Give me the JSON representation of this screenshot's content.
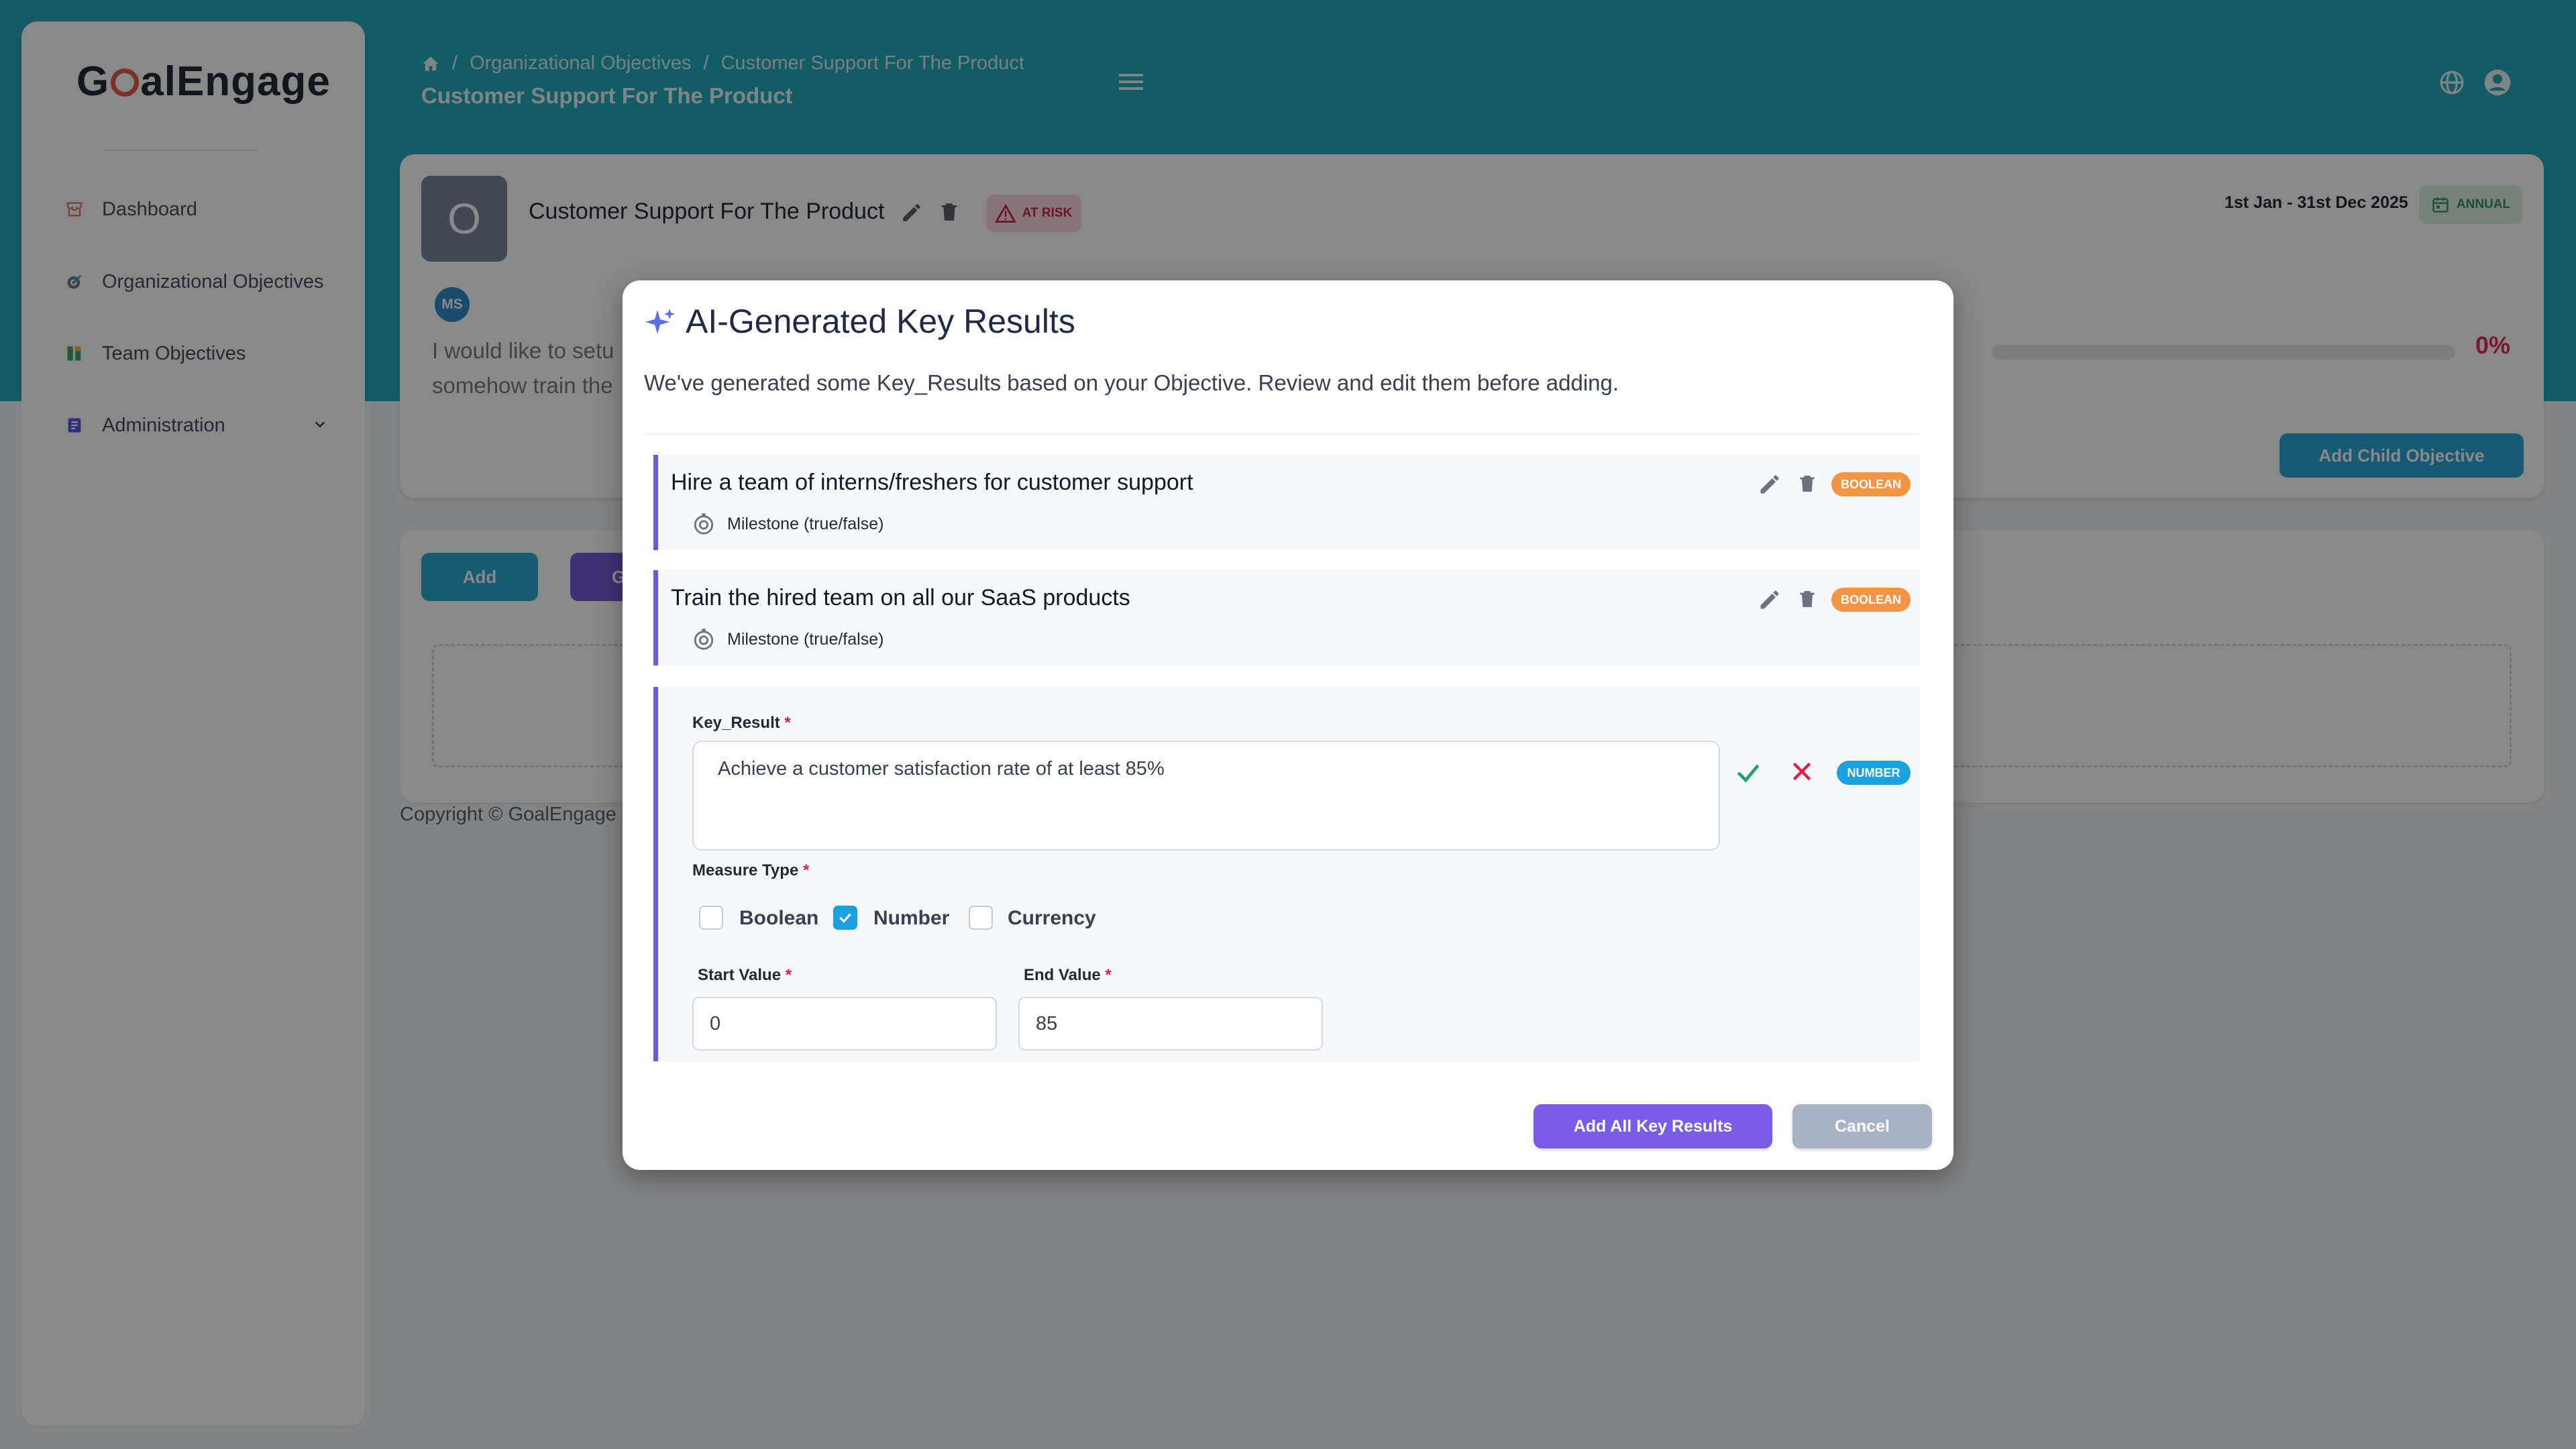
{
  "app": {
    "logo_prefix": "G",
    "logo_suffix": "alEngage"
  },
  "sidebar": {
    "items": [
      {
        "label": "Dashboard",
        "icon": "store-icon"
      },
      {
        "label": "Organizational Objectives",
        "icon": "target-icon"
      },
      {
        "label": "Team Objectives",
        "icon": "team-icon"
      },
      {
        "label": "Administration",
        "icon": "document-icon"
      }
    ]
  },
  "header": {
    "breadcrumb": [
      "Organizational Objectives",
      "Customer Support For The Product"
    ],
    "breadcrumb_sep": "/",
    "title": "Customer Support For The Product"
  },
  "objective": {
    "avatar_letter": "O",
    "title": "Customer Support For The Product",
    "status": "AT RISK",
    "owner_initials": "MS",
    "description_line1": "I would like to setu",
    "description_line2": "somehow train the",
    "date_range": "1st Jan - 31st Dec 2025",
    "period": "ANNUAL",
    "progress_percent": 0,
    "progress_label": "0%",
    "add_child_label": "Add Child Objective",
    "colors": {
      "accent": "#13a3b7",
      "at_risk": "#c0143c"
    }
  },
  "actions": {
    "add_label": "Add",
    "generate_label_visible": "G"
  },
  "footer": {
    "copyright": "Copyright © GoalEngage 2"
  },
  "modal": {
    "title": "AI-Generated Key Results",
    "subtitle": "We've generated some Key_Results based on your Objective. Review and edit them before adding.",
    "key_results": [
      {
        "title": "Hire a team of interns/freshers for customer support",
        "type_label": "Milestone (true/false)",
        "badge": "BOOLEAN"
      },
      {
        "title": "Train the hired team on all our SaaS products",
        "type_label": "Milestone (true/false)",
        "badge": "BOOLEAN"
      }
    ],
    "editing": {
      "key_result_label": "Key_Result",
      "key_result_value": "Achieve a customer satisfaction rate of at least 85%",
      "badge": "NUMBER",
      "measure_type_label": "Measure Type",
      "measure_options": [
        {
          "label": "Boolean",
          "checked": false
        },
        {
          "label": "Number",
          "checked": true
        },
        {
          "label": "Currency",
          "checked": false
        }
      ],
      "start_label": "Start Value",
      "start_value": "0",
      "end_label": "End Value",
      "end_value": "85",
      "required_mark": "*"
    },
    "add_all_label": "Add All Key Results",
    "cancel_label": "Cancel"
  }
}
